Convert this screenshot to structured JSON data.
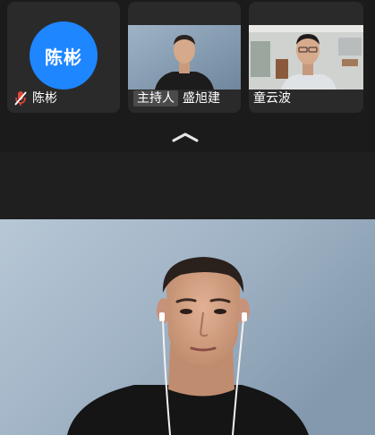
{
  "participants": [
    {
      "name": "陈彬",
      "avatar_text": "陈彬",
      "mic": "muted-icon",
      "avatar_color": "#1e86ff"
    },
    {
      "name": "盛旭建",
      "role_badge": "主持人"
    },
    {
      "name": "童云波"
    }
  ],
  "controls": {
    "collapse_icon": "chevron-up-icon"
  },
  "colors": {
    "background": "#1f1f1f",
    "tile": "#2a2a2a",
    "accent": "#1e86ff",
    "badge": "#4a4a4a",
    "mute": "#e0463a"
  }
}
